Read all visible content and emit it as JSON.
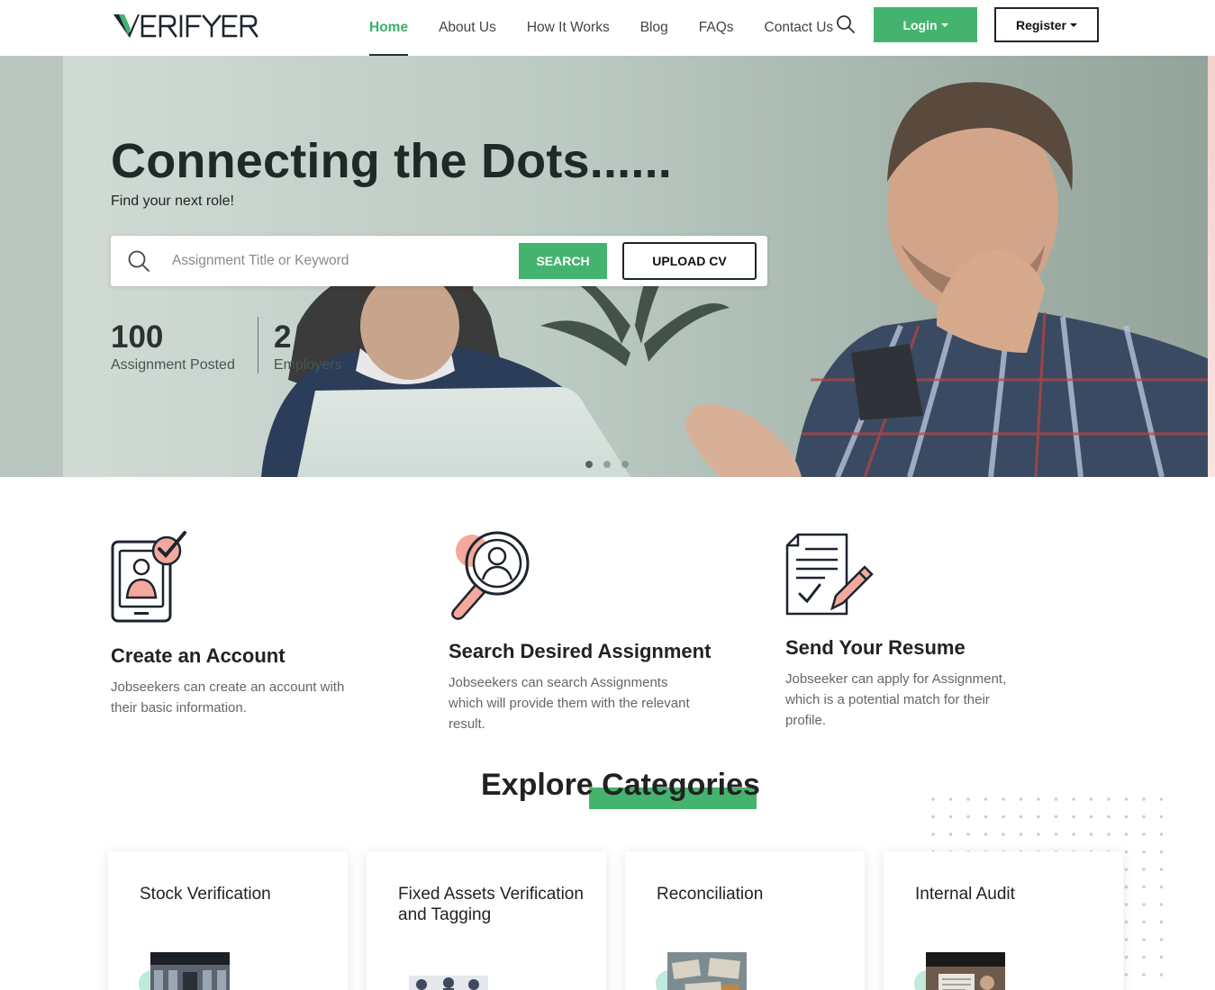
{
  "brand": {
    "logo_text": "VERIFYER",
    "accent_color": "#44b36e",
    "secondary_color": "#f4a99c",
    "dark_color": "#1d2430"
  },
  "nav": {
    "links": [
      {
        "label": "Home",
        "active": true
      },
      {
        "label": "About Us",
        "active": false
      },
      {
        "label": "How It Works",
        "active": false
      },
      {
        "label": "Blog",
        "active": false
      },
      {
        "label": "FAQs",
        "active": false
      },
      {
        "label": "Contact Us",
        "active": false
      }
    ],
    "search_icon": "search-icon",
    "login_label": "Login",
    "register_label": "Register"
  },
  "hero": {
    "title": "Connecting the Dots......",
    "subtitle": "Find your next role!",
    "search": {
      "placeholder": "Assignment Title or Keyword",
      "value": "",
      "search_label": "SEARCH",
      "upload_label": "UPLOAD CV"
    },
    "stats": [
      {
        "value": "100",
        "label": "Assignment Posted"
      },
      {
        "value": "2",
        "label": "Employers"
      }
    ],
    "slider": {
      "slides": 3,
      "active_index": 0
    }
  },
  "features": [
    {
      "icon": "account-phone-check-icon",
      "title": "Create an Account",
      "description": "Jobseekers can create an account with their basic information."
    },
    {
      "icon": "magnifier-person-icon",
      "title": "Search Desired Assignment",
      "description": "Jobseekers can search Assignments which will provide them with the relevant result."
    },
    {
      "icon": "document-pen-icon",
      "title": "Send Your Resume",
      "description": "Jobseeker can apply for Assignment, which is a potential match for their profile."
    }
  ],
  "categories": {
    "heading_part1": "Explore",
    "heading_part2": "Categories",
    "items": [
      {
        "title": "Stock Verification"
      },
      {
        "title": "Fixed Assets Verification and Tagging"
      },
      {
        "title": "Reconciliation"
      },
      {
        "title": "Internal Audit"
      }
    ]
  }
}
